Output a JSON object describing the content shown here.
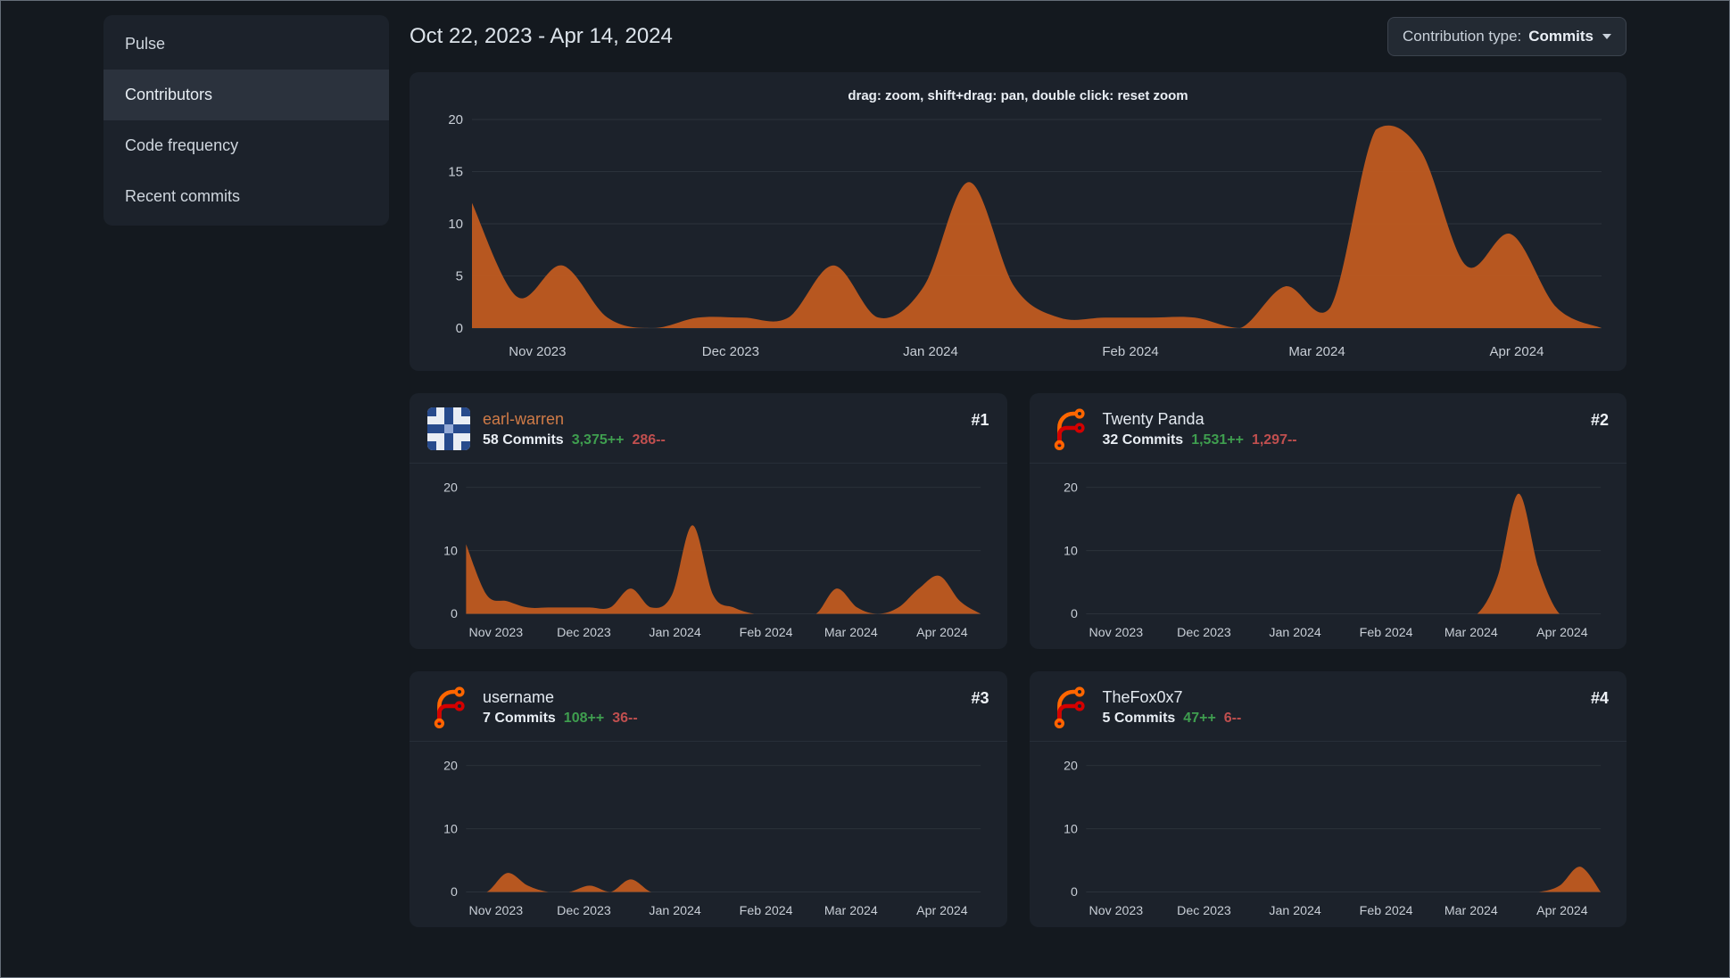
{
  "theme": {
    "page_bg": "#14191f",
    "panel_bg": "#1c222b",
    "panel_active": "#2b323d",
    "outer_border": "#666e78",
    "grid_color": "#2b323b",
    "tick_color": "#c8ced6",
    "text_color": "#d6dde4",
    "accent_orange": "#d07b47",
    "area_color": "#bd5a20",
    "additions_green": "#3f9e4f",
    "deletions_red": "#c04f4f"
  },
  "sidebar": {
    "items": [
      {
        "label": "Pulse",
        "active": false
      },
      {
        "label": "Contributors",
        "active": true
      },
      {
        "label": "Code frequency",
        "active": false
      },
      {
        "label": "Recent commits",
        "active": false
      }
    ]
  },
  "header": {
    "date_range": "Oct 22, 2023 - Apr 14, 2024",
    "contribution_type": {
      "label": "Contribution type:",
      "value": "Commits"
    }
  },
  "contributors": [
    {
      "name": "earl-warren",
      "rank": "#1",
      "commits": "58 Commits",
      "additions": "3,375++",
      "deletions": "286--",
      "avatar_icon": "identicon-avatar",
      "name_accent": true
    },
    {
      "name": "Twenty Panda",
      "rank": "#2",
      "commits": "32 Commits",
      "additions": "1,531++",
      "deletions": "1,297--",
      "avatar_icon": "forgejo-logo-icon",
      "name_accent": false
    },
    {
      "name": "username",
      "rank": "#3",
      "commits": "7 Commits",
      "additions": "108++",
      "deletions": "36--",
      "avatar_icon": "forgejo-logo-icon",
      "name_accent": false
    },
    {
      "name": "TheFox0x7",
      "rank": "#4",
      "commits": "5 Commits",
      "additions": "47++",
      "deletions": "6--",
      "avatar_icon": "forgejo-logo-icon",
      "name_accent": false
    }
  ],
  "chart_data": [
    {
      "id": "overall-commits",
      "type": "area",
      "hint": "drag: zoom, shift+drag: pan, double click: reset zoom",
      "ylim": [
        0,
        20
      ],
      "y_ticks": [
        0,
        5,
        10,
        15,
        20
      ],
      "x_ticks": [
        {
          "label": "Nov 2023",
          "pos": 0.058
        },
        {
          "label": "Dec 2023",
          "pos": 0.229
        },
        {
          "label": "Jan 2024",
          "pos": 0.406
        },
        {
          "label": "Feb 2024",
          "pos": 0.583
        },
        {
          "label": "Mar 2024",
          "pos": 0.748
        },
        {
          "label": "Apr 2024",
          "pos": 0.925
        }
      ],
      "values": [
        12,
        3,
        6,
        1,
        0,
        1,
        1,
        1,
        6,
        1,
        4,
        14,
        4,
        1,
        1,
        1,
        1,
        0,
        4,
        2,
        19,
        17,
        6,
        9,
        2,
        0
      ]
    },
    {
      "id": "earl-warren-commits",
      "type": "area",
      "ylim": [
        0,
        20
      ],
      "y_ticks": [
        0,
        10,
        20
      ],
      "x_ticks": [
        {
          "label": "Nov 2023",
          "pos": 0.058
        },
        {
          "label": "Dec 2023",
          "pos": 0.229
        },
        {
          "label": "Jan 2024",
          "pos": 0.406
        },
        {
          "label": "Feb 2024",
          "pos": 0.583
        },
        {
          "label": "Mar 2024",
          "pos": 0.748
        },
        {
          "label": "Apr 2024",
          "pos": 0.925
        }
      ],
      "values": [
        11,
        3,
        2,
        1,
        1,
        1,
        1,
        1,
        4,
        1,
        3,
        14,
        3,
        1,
        0,
        0,
        0,
        0,
        4,
        1,
        0,
        1,
        4,
        6,
        2,
        0
      ]
    },
    {
      "id": "twenty-panda-commits",
      "type": "area",
      "ylim": [
        0,
        20
      ],
      "y_ticks": [
        0,
        10,
        20
      ],
      "x_ticks": [
        {
          "label": "Nov 2023",
          "pos": 0.058
        },
        {
          "label": "Dec 2023",
          "pos": 0.229
        },
        {
          "label": "Jan 2024",
          "pos": 0.406
        },
        {
          "label": "Feb 2024",
          "pos": 0.583
        },
        {
          "label": "Mar 2024",
          "pos": 0.748
        },
        {
          "label": "Apr 2024",
          "pos": 0.925
        }
      ],
      "values": [
        0,
        0,
        0,
        0,
        0,
        0,
        0,
        0,
        0,
        0,
        0,
        0,
        0,
        0,
        0,
        0,
        0,
        0,
        0,
        0,
        6,
        19,
        7,
        0,
        0,
        0
      ]
    },
    {
      "id": "username-commits",
      "type": "area",
      "ylim": [
        0,
        20
      ],
      "y_ticks": [
        0,
        10,
        20
      ],
      "x_ticks": [
        {
          "label": "Nov 2023",
          "pos": 0.058
        },
        {
          "label": "Dec 2023",
          "pos": 0.229
        },
        {
          "label": "Jan 2024",
          "pos": 0.406
        },
        {
          "label": "Feb 2024",
          "pos": 0.583
        },
        {
          "label": "Mar 2024",
          "pos": 0.748
        },
        {
          "label": "Apr 2024",
          "pos": 0.925
        }
      ],
      "values": [
        0,
        0,
        3,
        1,
        0,
        0,
        1,
        0,
        2,
        0,
        0,
        0,
        0,
        0,
        0,
        0,
        0,
        0,
        0,
        0,
        0,
        0,
        0,
        0,
        0,
        0
      ]
    },
    {
      "id": "thefox0x7-commits",
      "type": "area",
      "ylim": [
        0,
        20
      ],
      "y_ticks": [
        0,
        10,
        20
      ],
      "x_ticks": [
        {
          "label": "Nov 2023",
          "pos": 0.058
        },
        {
          "label": "Dec 2023",
          "pos": 0.229
        },
        {
          "label": "Jan 2024",
          "pos": 0.406
        },
        {
          "label": "Feb 2024",
          "pos": 0.583
        },
        {
          "label": "Mar 2024",
          "pos": 0.748
        },
        {
          "label": "Apr 2024",
          "pos": 0.925
        }
      ],
      "values": [
        0,
        0,
        0,
        0,
        0,
        0,
        0,
        0,
        0,
        0,
        0,
        0,
        0,
        0,
        0,
        0,
        0,
        0,
        0,
        0,
        0,
        0,
        0,
        1,
        4,
        0
      ]
    }
  ]
}
